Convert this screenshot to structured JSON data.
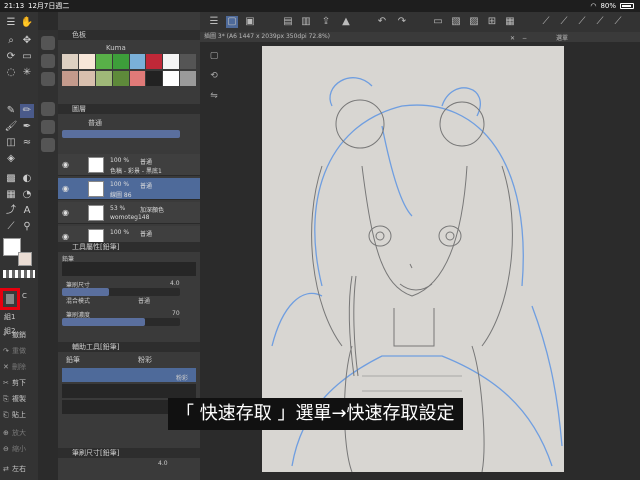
{
  "status": {
    "time": "21:13",
    "date": "12月7日週二",
    "battery": "80%"
  },
  "tools": {
    "icons": [
      "zoom-icon",
      "move-icon",
      "select-lasso-icon",
      "select-rect-icon",
      "pen-icon",
      "pencil-icon",
      "brush-icon",
      "airbrush-icon",
      "blend-icon",
      "fill-icon",
      "gradient-icon",
      "figure-icon",
      "text-icon",
      "ruler-icon",
      "eyedropper-icon",
      "correct-line-icon"
    ],
    "main_color": "#ffffff",
    "sub_color": "#ebddd4",
    "quick_access_letter": "C"
  },
  "side_labels": {
    "g1": "組1",
    "g2": "組2"
  },
  "menu": [
    {
      "icon": "↶",
      "label": "撤銷",
      "dim": false
    },
    {
      "icon": "↷",
      "label": "重做",
      "dim": true
    },
    {
      "icon": "✕",
      "label": "刪除",
      "dim": true
    },
    {
      "icon": "✂",
      "label": "剪下",
      "dim": false
    },
    {
      "icon": "⎘",
      "label": "複製",
      "dim": false
    },
    {
      "icon": "⎗",
      "label": "貼上",
      "dim": false
    },
    {
      "icon": "⊕",
      "label": "放大",
      "dim": true
    },
    {
      "icon": "⊖",
      "label": "縮小",
      "dim": true
    },
    {
      "icon": "⇄",
      "label": "左右",
      "dim": false
    }
  ],
  "panels": {
    "color_set": {
      "title": "色板",
      "name": "Kuma"
    },
    "swatches": [
      "#ddd0c2",
      "#f7e6d8",
      "#58b048",
      "#3d9e3a",
      "#7ab0d8",
      "#c02838",
      "#f4f4f4",
      "#555555",
      "#c49a8c",
      "#d8bfae",
      "#9fb878",
      "#5e8a3a",
      "#e07a78",
      "#222222",
      "#ffffff",
      "#9a9a9a"
    ],
    "layer": {
      "title": "圖層",
      "blend": "普通",
      "rows": [
        {
          "pct": "100 %",
          "mode": "普通",
          "name": "色稿 - 彩景 - 黑底1",
          "sel": false
        },
        {
          "pct": "100 %",
          "mode": "普通",
          "name": "線圖 86",
          "sel": true
        },
        {
          "pct": "53 %",
          "mode": "加深顏色",
          "name": "womoteg148",
          "sel": false
        },
        {
          "pct": "100 %",
          "mode": "普通",
          "name": "",
          "sel": false
        }
      ]
    },
    "tool_property": {
      "title": "工具屬性[鉛筆]",
      "brush_name": "鉛筆",
      "size_label": "筆刷尺寸",
      "size_value": "4.0",
      "blend_label": "混合模式",
      "blend_value": "普通",
      "density_label": "筆刷濃度",
      "density_value": "70",
      "density_fraction": 0.7
    },
    "sub_tool": {
      "title": "輔助工具[鉛筆]",
      "tab1": "鉛筆",
      "tab2": "粉彩",
      "item_label": "粉彩"
    },
    "brush_size": {
      "title": "筆刷尺寸[鉛筆]",
      "value": "4.0"
    }
  },
  "document": {
    "tab": "插圖 3* (A6 1447 x 2039px 350dpi 72.8%)",
    "navigator": "選單"
  },
  "subtitle": "「 快速存取 」選單→快速存取設定"
}
